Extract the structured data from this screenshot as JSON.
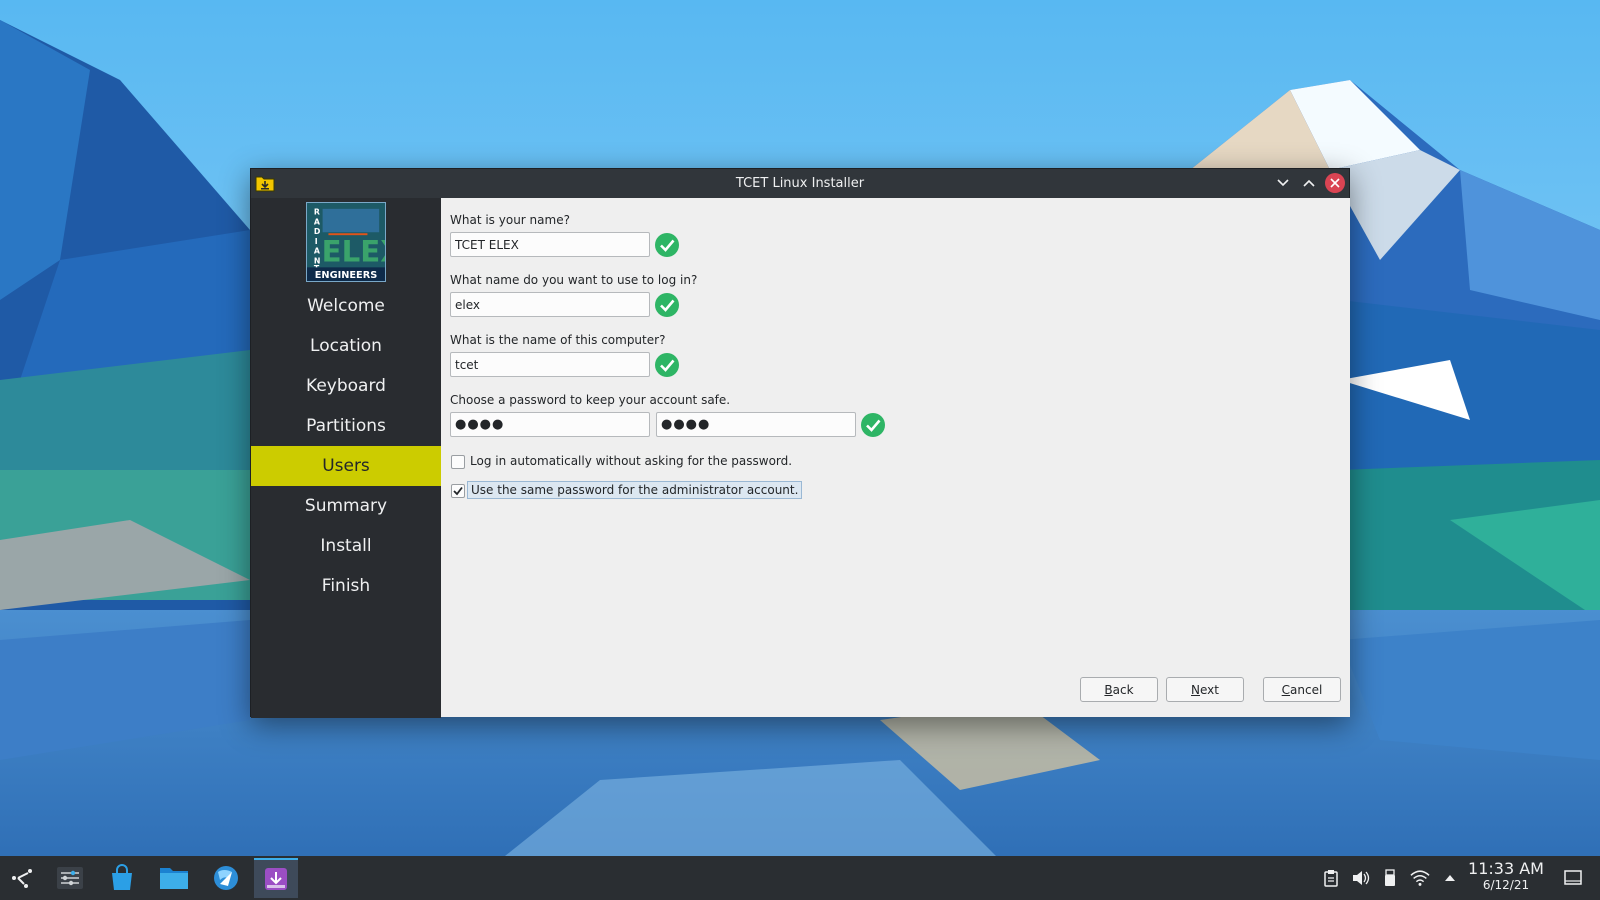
{
  "window": {
    "title": "TCET Linux Installer",
    "logo_text_top": "RADIANT",
    "logo_text_main": "ELEX",
    "logo_text_bottom": "ENGINEERS"
  },
  "sidebar": {
    "steps": [
      "Welcome",
      "Location",
      "Keyboard",
      "Partitions",
      "Users",
      "Summary",
      "Install",
      "Finish"
    ],
    "active": "Users"
  },
  "form": {
    "name_label": "What is your name?",
    "name_value": "TCET ELEX",
    "login_label": "What name do you want to use to log in?",
    "login_value": "elex",
    "computer_label": "What is the name of this computer?",
    "computer_value": "tcet",
    "password_label": "Choose a password to keep your account safe.",
    "password_value": "●●●●",
    "password_confirm_value": "●●●●",
    "autologin_label": "Log in automatically without asking for the password.",
    "autologin_checked": false,
    "same_admin_label": "Use the same password for the administrator account.",
    "same_admin_checked": true
  },
  "buttons": {
    "back_mnemonic": "B",
    "back_rest": "ack",
    "next_mnemonic": "N",
    "next_rest": "ext",
    "cancel_mnemonic": "C",
    "cancel_rest": "ancel"
  },
  "taskbar": {
    "time": "11:33 AM",
    "date": "6/12/21",
    "launchers": [
      "application-launcher-icon",
      "system-settings-icon",
      "discover-store-icon",
      "file-manager-icon",
      "web-browser-icon",
      "installer-icon"
    ]
  },
  "colors": {
    "accent_active_step": "#cccc00",
    "check_ok": "#2eb565",
    "close_button": "#da4453"
  }
}
